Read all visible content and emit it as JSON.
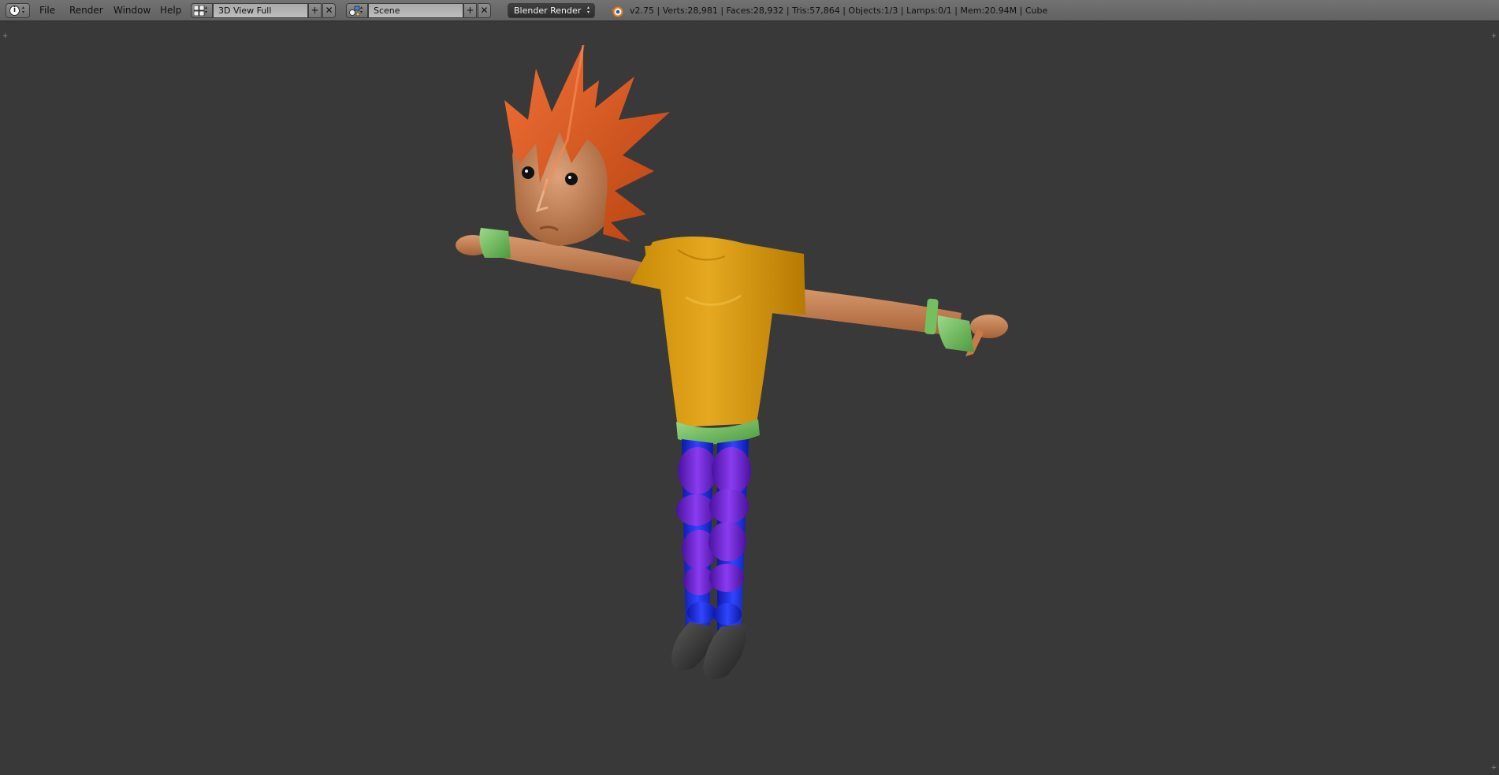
{
  "menu": {
    "items": [
      {
        "label": "File"
      },
      {
        "label": "Render"
      },
      {
        "label": "Window"
      },
      {
        "label": "Help"
      }
    ]
  },
  "screen_layout": {
    "value": "3D View Full"
  },
  "scene": {
    "value": "Scene"
  },
  "render_engine": {
    "value": "Blender Render"
  },
  "stats": {
    "text": "v2.75 | Verts:28,981 | Faces:28,932 | Tris:57,864 | Objects:1/3 | Lamps:0/1 | Mem:20.94M | Cube"
  },
  "icons": {
    "editor_type": "info-icon",
    "screen_layout": "layout-grid-icon",
    "scene": "scene-icon",
    "add": "plus-icon",
    "remove": "x-icon",
    "logo": "blender-logo-icon"
  },
  "colors": {
    "header": "#6a6a6a",
    "viewport": "#393939",
    "hair": "#d9551e",
    "skin": "#c97f4d",
    "shirt": "#d69a10",
    "gloves": "#6fb85a",
    "pants": "#1a2bd8",
    "leg_rings": "#6a1fc8",
    "shoes": "#2e2e2e"
  }
}
